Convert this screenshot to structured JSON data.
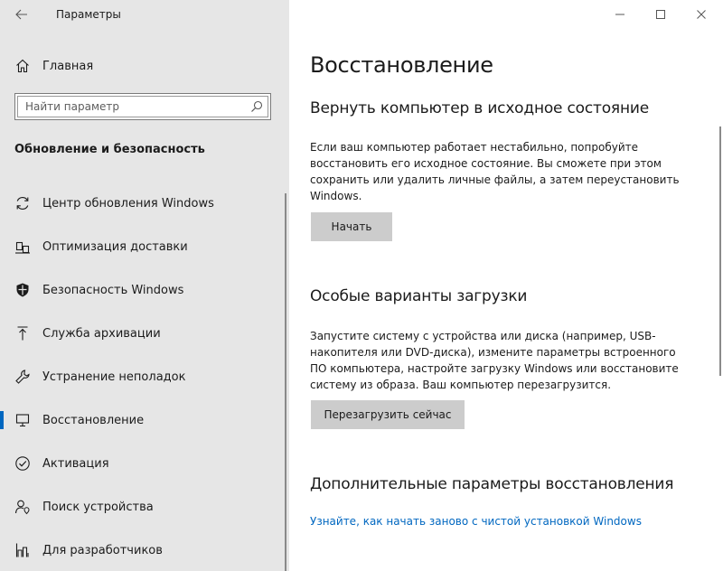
{
  "app": {
    "title": "Параметры"
  },
  "sidebar": {
    "home_label": "Главная",
    "search_placeholder": "Найти параметр",
    "section_title": "Обновление и безопасность",
    "items": [
      {
        "label": "Центр обновления Windows",
        "icon": "sync-icon"
      },
      {
        "label": "Оптимизация доставки",
        "icon": "delivery-icon"
      },
      {
        "label": "Безопасность Windows",
        "icon": "shield-icon"
      },
      {
        "label": "Служба архивации",
        "icon": "upload-arrow-icon"
      },
      {
        "label": "Устранение неполадок",
        "icon": "wrench-icon"
      },
      {
        "label": "Восстановление",
        "icon": "recovery-icon",
        "selected": true
      },
      {
        "label": "Активация",
        "icon": "check-circle-icon"
      },
      {
        "label": "Поиск устройства",
        "icon": "person-location-icon"
      },
      {
        "label": "Для разработчиков",
        "icon": "developer-icon"
      }
    ]
  },
  "main": {
    "page_title": "Восстановление",
    "reset": {
      "heading": "Вернуть компьютер в исходное состояние",
      "description": "Если ваш компьютер работает нестабильно, попробуйте восстановить его исходное состояние. Вы сможете при этом сохранить или удалить личные файлы, а затем переустановить Windows.",
      "button": "Начать"
    },
    "advanced_startup": {
      "heading": "Особые варианты загрузки",
      "description": "Запустите систему с устройства или диска (например, USB-накопителя или DVD-диска), измените параметры встроенного ПО компьютера, настройте загрузку Windows или восстановите систему из образа. Ваш компьютер перезагрузится.",
      "button": "Перезагрузить сейчас"
    },
    "more_recovery": {
      "heading": "Дополнительные параметры восстановления",
      "link": "Узнайте, как начать заново с чистой установкой Windows"
    }
  },
  "colors": {
    "sidebar_bg": "#e6e6e6",
    "accent": "#0067c0",
    "button_bg": "#cccccc"
  }
}
